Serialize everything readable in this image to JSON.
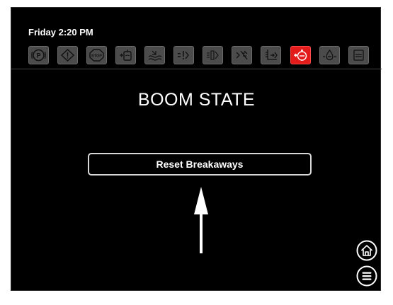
{
  "status": {
    "clock": "Friday 2:20 PM"
  },
  "toolbar": {
    "icons": [
      {
        "name": "parking-brake-icon",
        "active": false
      },
      {
        "name": "warning-icon",
        "active": false
      },
      {
        "name": "stop-icon",
        "active": false,
        "text": "STOP"
      },
      {
        "name": "tank-icon",
        "active": false
      },
      {
        "name": "water-level-icon",
        "active": false
      },
      {
        "name": "boom-center-icon",
        "active": false
      },
      {
        "name": "boom-sections-icon",
        "active": false
      },
      {
        "name": "nozzle-icon",
        "active": false
      },
      {
        "name": "boom-height-icon",
        "active": false
      },
      {
        "name": "boom-breakaway-icon",
        "active": true
      },
      {
        "name": "flow-icon",
        "active": false
      },
      {
        "name": "fill-icon",
        "active": false
      }
    ],
    "active_color": "#e31b1b"
  },
  "main": {
    "title": "BOOM STATE",
    "reset_label": "Reset Breakaways"
  },
  "nav": {
    "home_icon": "home-icon",
    "menu_icon": "menu-icon"
  }
}
